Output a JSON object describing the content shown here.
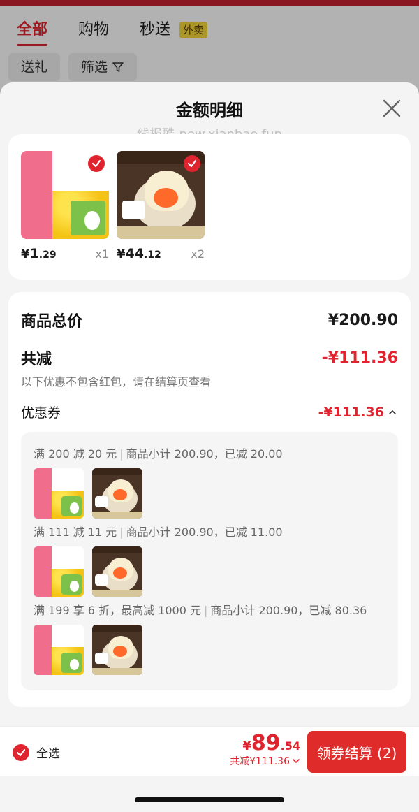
{
  "background_page": {
    "tabs": [
      {
        "label": "全部",
        "active": true
      },
      {
        "label": "购物",
        "active": false
      },
      {
        "label": "秒送",
        "active": false,
        "badge": "外卖"
      }
    ],
    "chips": [
      "送礼",
      "筛选"
    ]
  },
  "sheet": {
    "title": "金额明细",
    "watermark": "线报酷-new.xianbao.fun"
  },
  "products": [
    {
      "price_symbol": "¥",
      "price_int": "1",
      "price_dec": ".29",
      "qty": "x1",
      "image": "sweet-corn-kernels",
      "checked": true
    },
    {
      "price_symbol": "¥",
      "price_int": "44",
      "price_dec": ".12",
      "qty": "x2",
      "image": "shrimp-wonton-dumplings",
      "checked": true
    }
  ],
  "summary": {
    "total_label": "商品总价",
    "total_value": "¥200.90",
    "reduce_label": "共减",
    "reduce_value": "-¥111.36",
    "note": "以下优惠不包含红包，请在结算页查看",
    "coupon_label": "优惠券",
    "coupon_value": "-¥111.36"
  },
  "coupons": [
    {
      "rule": "满 200 减 20 元",
      "detail": "商品小计 200.90，已减 20.00"
    },
    {
      "rule": "满 111 减 11 元",
      "detail": "商品小计 200.90，已减 11.00"
    },
    {
      "rule": "满 199 享 6 折，最高减 1000 元",
      "detail": "商品小计 200.90，已减 80.36"
    }
  ],
  "bottom": {
    "select_all": "全选",
    "pay_symbol": "¥",
    "pay_int": "89",
    "pay_dec": ".54",
    "saved": "共减¥111.36",
    "checkout": "领券结算 (2)"
  },
  "colors": {
    "accent_red": "#e0242f",
    "checkout_red": "#e02b2b",
    "badge_yellow": "#f5d93a"
  }
}
